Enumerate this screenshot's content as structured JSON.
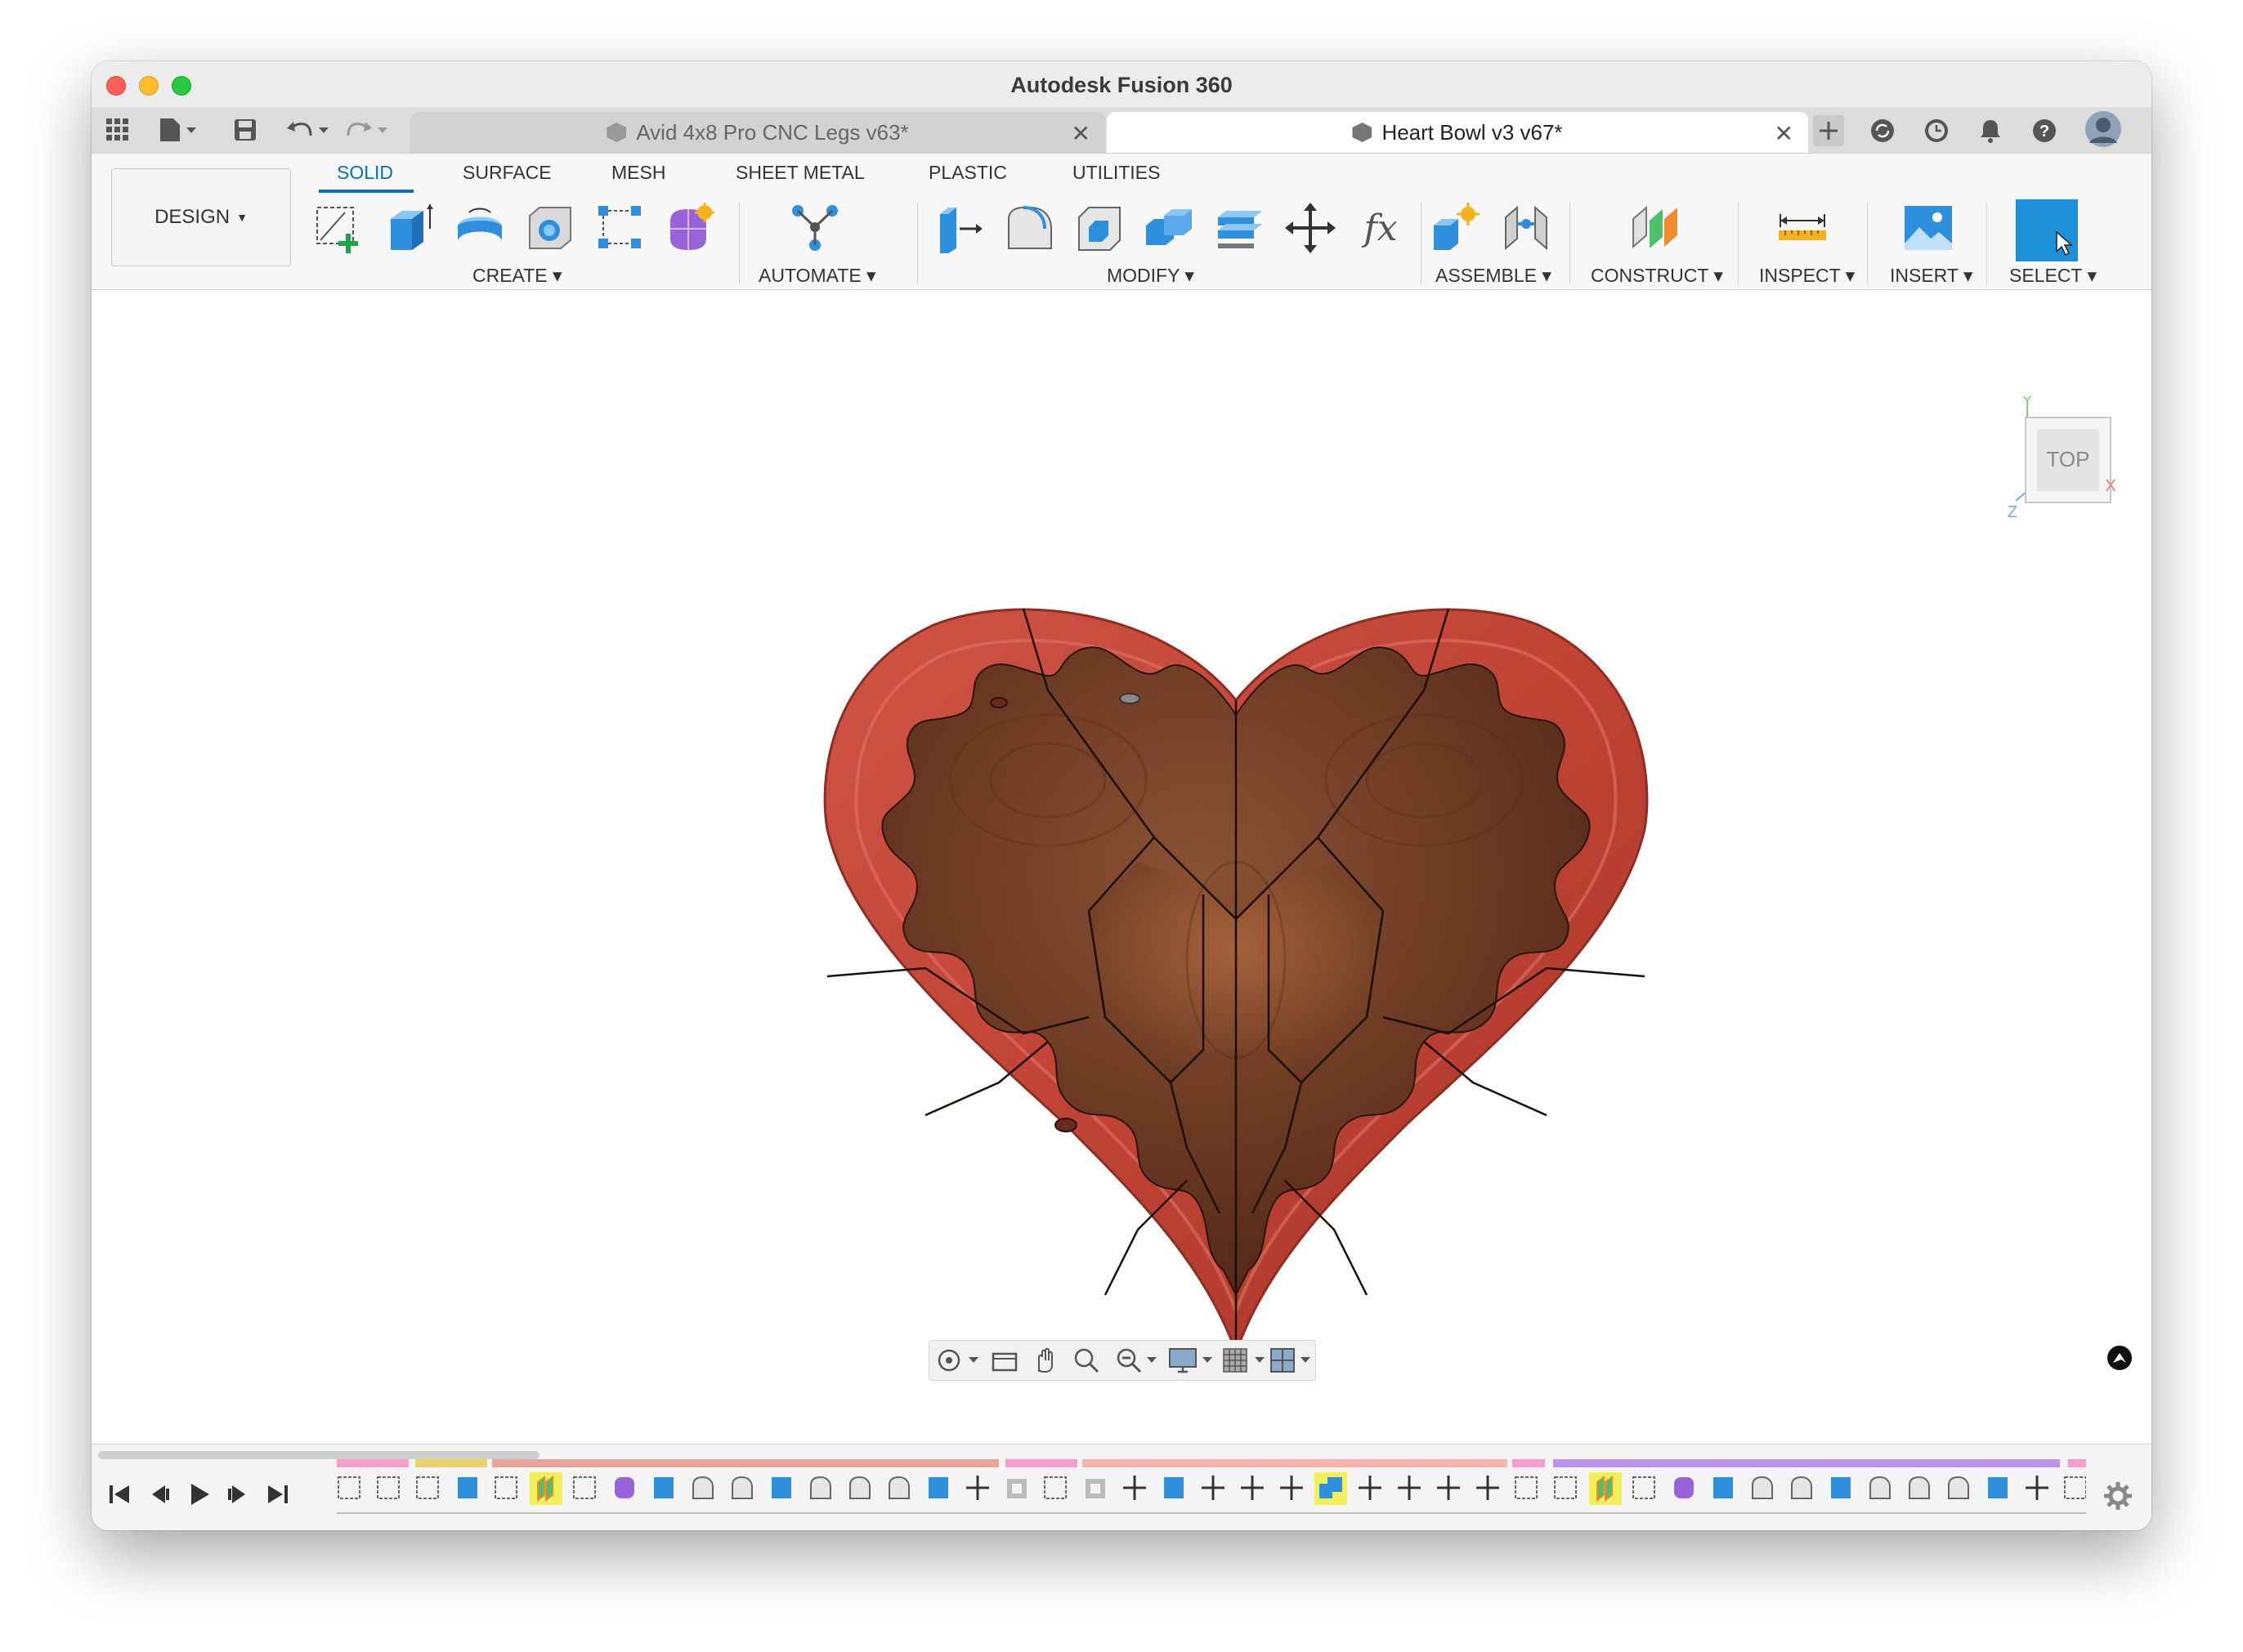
{
  "window": {
    "title": "Autodesk Fusion 360"
  },
  "tabs": [
    {
      "label": "Avid 4x8 Pro CNC Legs v63*",
      "active": false
    },
    {
      "label": "Heart Bowl v3 v67*",
      "active": true
    }
  ],
  "toolbar": {
    "workspace_button": "DESIGN",
    "workspace_tabs": [
      {
        "label": "SOLID",
        "active": true
      },
      {
        "label": "SURFACE"
      },
      {
        "label": "MESH"
      },
      {
        "label": "SHEET METAL"
      },
      {
        "label": "PLASTIC"
      },
      {
        "label": "UTILITIES"
      }
    ],
    "groups": {
      "create": "CREATE",
      "automate": "AUTOMATE",
      "modify": "MODIFY",
      "assemble": "ASSEMBLE",
      "construct": "CONSTRUCT",
      "inspect": "INSPECT",
      "insert": "INSERT",
      "select": "SELECT"
    }
  },
  "viewcube": {
    "face": "TOP",
    "axis_x": "X",
    "axis_y": "Y",
    "axis_z": "Z"
  },
  "colors": {
    "accent": "#0a6fc2",
    "bowl_rim": "#c5473a",
    "bowl_wood": "#6e3b22",
    "timeline_pink": "#f39fc7",
    "timeline_salmon": "#e8a49a",
    "timeline_purple": "#b995ee",
    "timeline_yellow": "#e8d06a"
  }
}
